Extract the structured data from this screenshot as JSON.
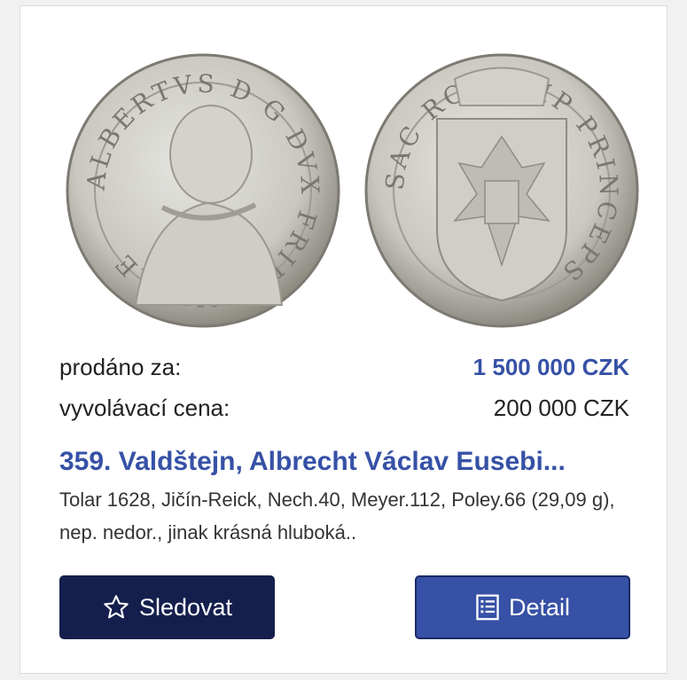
{
  "lot": {
    "sold_label": "prodáno za:",
    "sold_value": "1 500 000 CZK",
    "start_label": "vyvolávací cena:",
    "start_value": "200 000 CZK",
    "title": "359. Valdštejn, Albrecht Václav Eusebi...",
    "description": "Tolar 1628, Jičín-Reick, Nech.40, Meyer.112, Poley.66 (29,09 g), nep. nedor., jinak krásná hluboká.."
  },
  "coin_legends": {
    "obverse": "ALBERTVS D G DVX FRIDLANDIAE",
    "reverse": "SAC ROM IMP PRINCEPS"
  },
  "buttons": {
    "follow_label": "Sledovat",
    "follow_icon": "star-outline-icon",
    "detail_label": "Detail",
    "detail_icon": "list-document-icon"
  },
  "colors": {
    "accent": "#3651a6",
    "dark_button": "#141f4d"
  }
}
